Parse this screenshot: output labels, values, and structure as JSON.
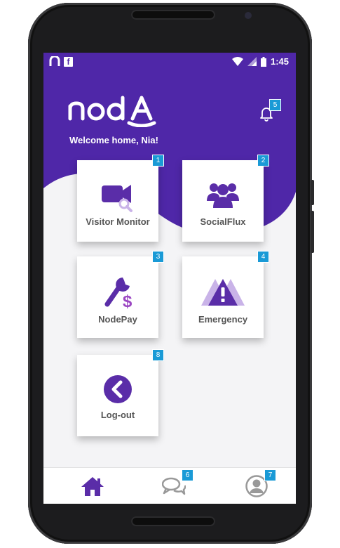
{
  "status_bar": {
    "time": "1:45",
    "left_icons": [
      "noda-app-icon",
      "facebook-icon"
    ],
    "right_icons": [
      "wifi-icon",
      "signal-icon",
      "battery-icon"
    ]
  },
  "header": {
    "logo_text": "nodA",
    "welcome": "Welcome home, Nia!",
    "notification_badge": "5"
  },
  "tiles": [
    {
      "label": "Visitor Monitor",
      "badge": "1",
      "icon": "video-camera-search-icon"
    },
    {
      "label": "SocialFlux",
      "badge": "2",
      "icon": "group-people-icon"
    },
    {
      "label": "NodePay",
      "badge": "3",
      "icon": "wrench-dollar-icon"
    },
    {
      "label": "Emergency",
      "badge": "4",
      "icon": "warning-triangle-icon"
    },
    {
      "label": "Log-out",
      "badge": "8",
      "icon": "back-chevron-circle-icon"
    }
  ],
  "bottom_nav": [
    {
      "icon": "home-icon",
      "badge": ""
    },
    {
      "icon": "chat-bubbles-icon",
      "badge": "6"
    },
    {
      "icon": "profile-icon",
      "badge": "7"
    }
  ],
  "colors": {
    "brand": "#4f27a8",
    "icon_purple": "#5a2da8",
    "badge_blue": "#1a9ad6"
  }
}
